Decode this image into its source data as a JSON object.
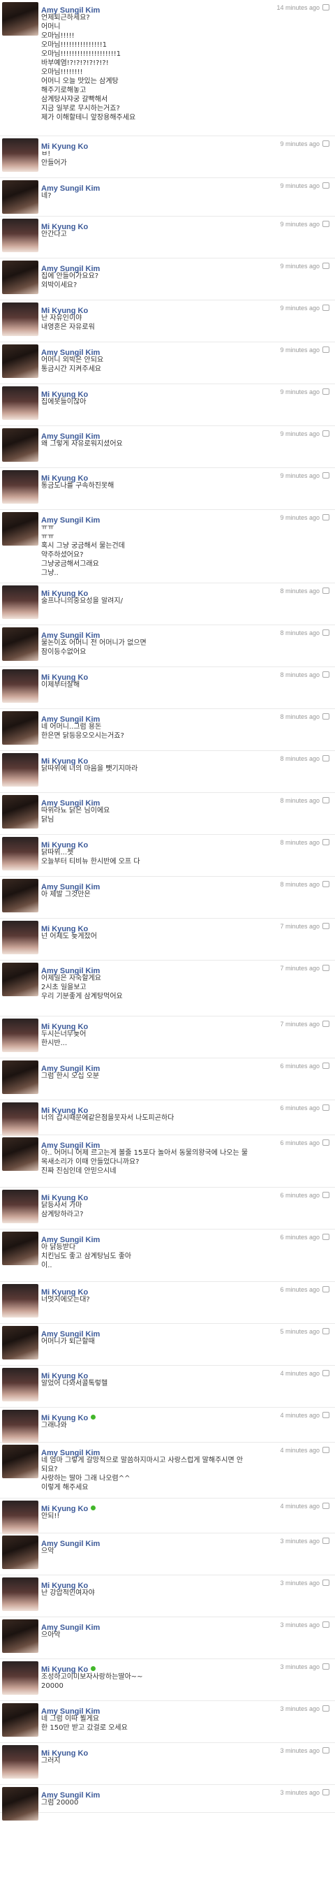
{
  "messages": [
    {
      "sender": "Amy Sungil Kim",
      "avatar": "amy",
      "online": false,
      "time": "14 minutes ago",
      "lines": [
        "언제퇴근하세요?",
        "어머니",
        "오마님!!!!!",
        "오마님!!!!!!!!!!!!!!!1",
        "오마님!!!!!!!!!!!!!!!!!!!!1",
        "바부예염!?!?!?!?!?!?!",
        "오마님!!!!!!!!",
        "어머니 오늘 맛있는 삼계탕",
        "해주기로해놓고",
        "삼계탕사쟈궁 갈빡해서",
        "지금 일부로 무시하는거죠?",
        "제가 이해할테니 앞장용해주세요"
      ]
    },
    {
      "sender": "Mi Kyung Ko",
      "avatar": "mi",
      "online": false,
      "time": "9 minutes ago",
      "lines": [
        "ㅂ!",
        "안들어가"
      ]
    },
    {
      "sender": "Amy Sungil Kim",
      "avatar": "amy",
      "online": false,
      "time": "9 minutes ago",
      "lines": [
        "네?"
      ]
    },
    {
      "sender": "Mi Kyung Ko",
      "avatar": "mi",
      "online": false,
      "time": "9 minutes ago",
      "lines": [
        "안간다고"
      ]
    },
    {
      "sender": "Amy Sungil Kim",
      "avatar": "amy",
      "online": false,
      "time": "9 minutes ago",
      "lines": [
        "집에 안들어가요요?",
        "외박이세요?"
      ]
    },
    {
      "sender": "Mi Kyung Ko",
      "avatar": "mi",
      "online": false,
      "time": "9 minutes ago",
      "lines": [
        "난 자유인이야",
        "내영혼은 자유로워"
      ]
    },
    {
      "sender": "Amy Sungil Kim",
      "avatar": "amy",
      "online": false,
      "time": "9 minutes ago",
      "lines": [
        "어머니 외박은 안되요",
        "통금시간 지켜주세요"
      ]
    },
    {
      "sender": "Mi Kyung Ko",
      "avatar": "mi",
      "online": false,
      "time": "9 minutes ago",
      "lines": [
        "집에못들이잖아"
      ]
    },
    {
      "sender": "Amy Sungil Kim",
      "avatar": "amy",
      "online": false,
      "time": "9 minutes ago",
      "lines": [
        "왜 그렇게 자유로워지셨어요"
      ]
    },
    {
      "sender": "Mi Kyung Ko",
      "avatar": "mi",
      "online": false,
      "time": "9 minutes ago",
      "lines": [
        "통금도나를 구속하진못해"
      ]
    },
    {
      "sender": "Amy Sungil Kim",
      "avatar": "amy",
      "online": false,
      "time": "9 minutes ago",
      "lines": [
        "ㅠㅠ",
        "ㅠㅠ",
        "혹시 그냥 궁금해서 물는건데",
        "약주하셨어요?",
        "그냥궁금해서그래요",
        "그냥.."
      ]
    },
    {
      "sender": "Mi Kyung Ko",
      "avatar": "mi",
      "online": false,
      "time": "8 minutes ago",
      "lines": [
        "술프나니의중요성을 알려지/"
      ]
    },
    {
      "sender": "Amy Sungil Kim",
      "avatar": "amy",
      "online": false,
      "time": "8 minutes ago",
      "lines": [
        "물논이죠 어머니 전 어머니가 없으면",
        "잠이등수없어요"
      ]
    },
    {
      "sender": "Mi Kyung Ko",
      "avatar": "mi",
      "online": false,
      "time": "8 minutes ago",
      "lines": [
        "이제부터잘해"
      ]
    },
    {
      "sender": "Amy Sungil Kim",
      "avatar": "amy",
      "online": false,
      "time": "8 minutes ago",
      "lines": [
        "네 어머니..그럼 용돈",
        "한은면 닭등응오오시는거죠?"
      ]
    },
    {
      "sender": "Mi Kyung Ko",
      "avatar": "mi",
      "online": false,
      "time": "8 minutes ago",
      "lines": [
        "닭따위에 너의 마음을 뺏기지마라"
      ]
    },
    {
      "sender": "Amy Sungil Kim",
      "avatar": "amy",
      "online": false,
      "time": "8 minutes ago",
      "lines": [
        "따위라뇨 닭은 님이에요",
        "닭님"
      ]
    },
    {
      "sender": "Mi Kyung Ko",
      "avatar": "mi",
      "online": false,
      "time": "8 minutes ago",
      "lines": [
        "닭따위...쳇",
        "오늘부터 티비뉴 한시반에 오프 다"
      ]
    },
    {
      "sender": "Amy Sungil Kim",
      "avatar": "amy",
      "online": false,
      "time": "8 minutes ago",
      "lines": [
        "아 제발 그것만은"
      ]
    },
    {
      "sender": "Mi Kyung Ko",
      "avatar": "mi",
      "online": false,
      "time": "7 minutes ago",
      "lines": [
        "넌 어제도 늦게잤어"
      ]
    },
    {
      "sender": "Amy Sungil Kim",
      "avatar": "amy",
      "online": false,
      "time": "7 minutes ago",
      "lines": [
        "어제일은 자숙할게요",
        "2시초 일을보고",
        "우리 기분좋게 삼계탕먹어요"
      ]
    },
    {
      "sender": "Mi Kyung Ko",
      "avatar": "mi",
      "online": false,
      "time": "7 minutes ago",
      "lines": [
        "두시는너무늦어",
        "한시반..."
      ]
    },
    {
      "sender": "Amy Sungil Kim",
      "avatar": "amy",
      "online": false,
      "time": "6 minutes ago",
      "lines": [
        "그럼 한시 오십 오분"
      ]
    },
    {
      "sender": "Mi Kyung Ko",
      "avatar": "mi",
      "online": false,
      "time": "6 minutes ago",
      "lines": [
        "너의 갑시때문에같은점을뭇자서 나도피곤하다"
      ]
    },
    {
      "sender": "Amy Sungil Kim",
      "avatar": "amy",
      "online": false,
      "time": "6 minutes ago",
      "lines": [
        "아.. 어머니 어제 르고는게 볼줄 15포다 놀아서 동물의왕국에 나오는 물",
        "목새소리가 이때 안들었다니까요?",
        "진짜 진심인데 안믿으시네"
      ]
    },
    {
      "sender": "Mi Kyung Ko",
      "avatar": "mi",
      "online": false,
      "time": "6 minutes ago",
      "lines": [
        "닭등사서 가마",
        "삼계탕하라고?"
      ]
    },
    {
      "sender": "Amy Sungil Kim",
      "avatar": "amy",
      "online": false,
      "time": "6 minutes ago",
      "lines": [
        "아 닭등받다",
        "치킨님도 좋고 삼계탕님도 좋아",
        "이.."
      ]
    },
    {
      "sender": "Mi Kyung Ko",
      "avatar": "mi",
      "online": false,
      "time": "6 minutes ago",
      "lines": [
        "너멋지에오는대?"
      ]
    },
    {
      "sender": "Amy Sungil Kim",
      "avatar": "amy",
      "online": false,
      "time": "5 minutes ago",
      "lines": [
        "어머니가 퇴근할때"
      ]
    },
    {
      "sender": "Mi Kyung Ko",
      "avatar": "mi",
      "online": false,
      "time": "4 minutes ago",
      "lines": [
        "알었어 다와서콜톡렇헬"
      ]
    },
    {
      "sender": "Mi Kyung Ko",
      "avatar": "mi",
      "online": true,
      "time": "4 minutes ago",
      "lines": [
        "그래나와"
      ]
    },
    {
      "sender": "Amy Sungil Kim",
      "avatar": "amy",
      "online": false,
      "time": "4 minutes ago",
      "lines": [
        "네 엄마 그렇게 갈망적으로 말씀하지마시고 사랑스럽게 말해주시면 안",
        "되요?",
        "사랑하는 딸아 그래 나오렴^^",
        "이렇게 해주세요"
      ]
    },
    {
      "sender": "Mi Kyung Ko",
      "avatar": "mi",
      "online": true,
      "time": "4 minutes ago",
      "lines": [
        "안되!!"
      ]
    },
    {
      "sender": "Amy Sungil Kim",
      "avatar": "amy",
      "online": false,
      "time": "3 minutes ago",
      "lines": [
        "으악"
      ]
    },
    {
      "sender": "Mi Kyung Ko",
      "avatar": "mi",
      "online": false,
      "time": "3 minutes ago",
      "lines": [
        "난 강압적인여자야"
      ]
    },
    {
      "sender": "Amy Sungil Kim",
      "avatar": "amy",
      "online": false,
      "time": "3 minutes ago",
      "lines": [
        "으아악"
      ]
    },
    {
      "sender": "Mi Kyung Ko",
      "avatar": "mi",
      "online": true,
      "time": "3 minutes ago",
      "lines": [
        "조성하고이미보자사랑하는딸아~~",
        "20000"
      ]
    },
    {
      "sender": "Amy Sungil Kim",
      "avatar": "amy",
      "online": false,
      "time": "3 minutes ago",
      "lines": [
        "네 그럼 이따 뵐게요",
        "한 150만 받고 갔걸로 오세요"
      ]
    },
    {
      "sender": "Mi Kyung Ko",
      "avatar": "mi",
      "online": false,
      "time": "3 minutes ago",
      "lines": [
        "그러지"
      ]
    },
    {
      "sender": "Amy Sungil Kim",
      "avatar": "amy",
      "online": false,
      "time": "3 minutes ago",
      "lines": [
        "그럼 20000"
      ]
    }
  ]
}
